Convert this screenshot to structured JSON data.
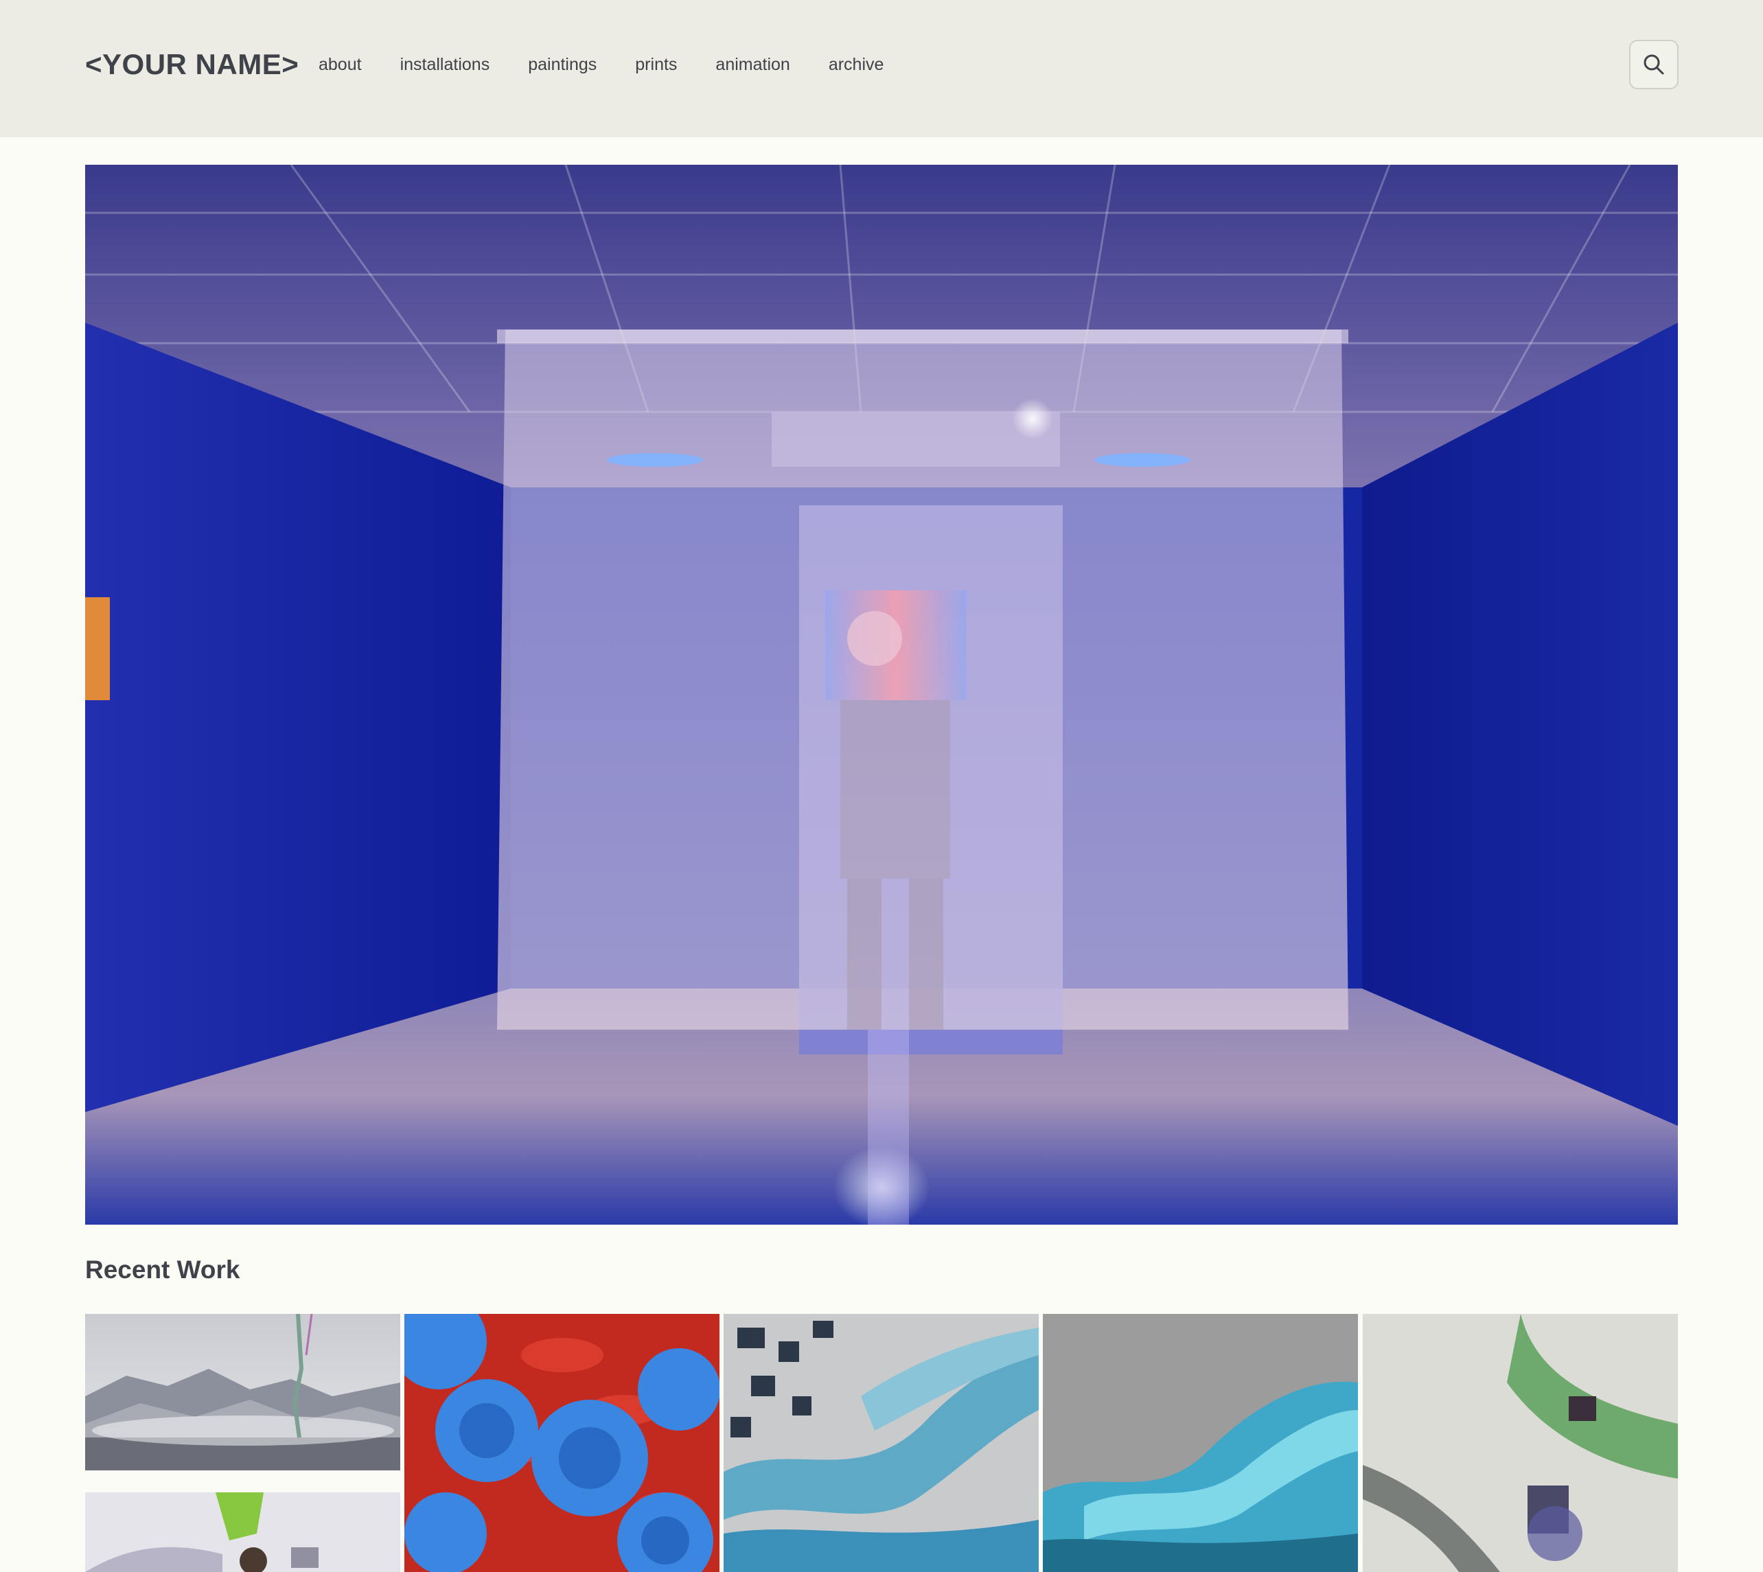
{
  "header": {
    "brand": "<YOUR NAME>",
    "nav": [
      "about",
      "installations",
      "paintings",
      "prints",
      "animation",
      "archive"
    ],
    "search_icon": "magnifier-icon"
  },
  "hero": {
    "image": "installation-photo"
  },
  "recent": {
    "title": "Recent Work",
    "thumbnails": [
      "misty-mountains-painting",
      "blue-peonies-on-red",
      "blue-cube-waves",
      "cyan-wave-render",
      "green-streams-render",
      "green-tendril-render"
    ]
  },
  "colors": {
    "header_bg": "#ecece4",
    "page_bg": "#fbfcf5",
    "text": "#3f4249",
    "gallery_blue": "#1a2fb0"
  }
}
